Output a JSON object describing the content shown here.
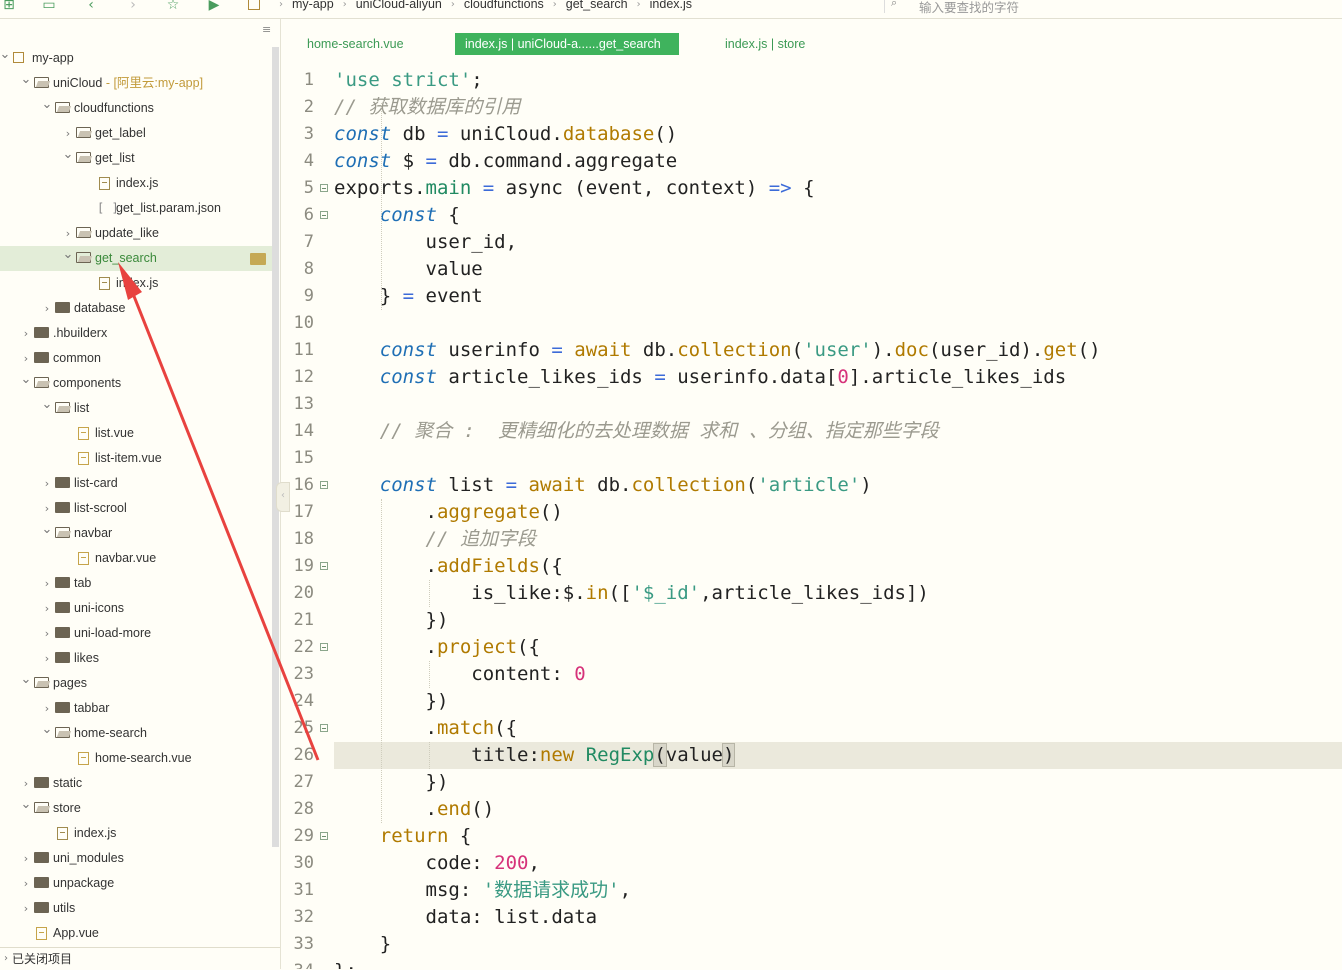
{
  "toolbar": {
    "icons": [
      "new-file-icon",
      "save-icon",
      "back-icon",
      "forward-icon",
      "star-icon",
      "run-icon"
    ],
    "breadcrumb": [
      "my-app",
      "uniCloud-aliyun",
      "cloudfunctions",
      "get_search",
      "index.js"
    ],
    "search_placeholder": "输入要查找的字符"
  },
  "sidebar": {
    "tree": [
      {
        "label": "my-app",
        "suffix": "",
        "depth": 0,
        "arrow": "down",
        "icon": "project"
      },
      {
        "label": "uniCloud",
        "suffix": " - [阿里云:my-app]",
        "depth": 1,
        "arrow": "down",
        "icon": "folder-open"
      },
      {
        "label": "cloudfunctions",
        "suffix": "",
        "depth": 2,
        "arrow": "down",
        "icon": "folder-open"
      },
      {
        "label": "get_label",
        "suffix": "",
        "depth": 3,
        "arrow": "right",
        "icon": "folder-open"
      },
      {
        "label": "get_list",
        "suffix": "",
        "depth": 3,
        "arrow": "down",
        "icon": "folder-open"
      },
      {
        "label": "index.js",
        "suffix": "",
        "depth": 4,
        "arrow": "",
        "icon": "file"
      },
      {
        "label": "get_list.param.json",
        "suffix": "",
        "depth": 4,
        "arrow": "",
        "icon": "json"
      },
      {
        "label": "update_like",
        "suffix": "",
        "depth": 3,
        "arrow": "right",
        "icon": "folder-open"
      },
      {
        "label": "get_search",
        "suffix": "",
        "depth": 3,
        "arrow": "down",
        "icon": "folder-open",
        "selected": true
      },
      {
        "label": "index.js",
        "suffix": "",
        "depth": 4,
        "arrow": "",
        "icon": "file"
      },
      {
        "label": "database",
        "suffix": "",
        "depth": 2,
        "arrow": "right",
        "icon": "folder"
      },
      {
        "label": ".hbuilderx",
        "suffix": "",
        "depth": 1,
        "arrow": "right",
        "icon": "folder"
      },
      {
        "label": "common",
        "suffix": "",
        "depth": 1,
        "arrow": "right",
        "icon": "folder"
      },
      {
        "label": "components",
        "suffix": "",
        "depth": 1,
        "arrow": "down",
        "icon": "folder-open"
      },
      {
        "label": "list",
        "suffix": "",
        "depth": 2,
        "arrow": "down",
        "icon": "folder-open"
      },
      {
        "label": "list.vue",
        "suffix": "",
        "depth": 3,
        "arrow": "",
        "icon": "vue"
      },
      {
        "label": "list-item.vue",
        "suffix": "",
        "depth": 3,
        "arrow": "",
        "icon": "vue"
      },
      {
        "label": "list-card",
        "suffix": "",
        "depth": 2,
        "arrow": "right",
        "icon": "folder"
      },
      {
        "label": "list-scrool",
        "suffix": "",
        "depth": 2,
        "arrow": "right",
        "icon": "folder"
      },
      {
        "label": "navbar",
        "suffix": "",
        "depth": 2,
        "arrow": "down",
        "icon": "folder-open"
      },
      {
        "label": "navbar.vue",
        "suffix": "",
        "depth": 3,
        "arrow": "",
        "icon": "vue"
      },
      {
        "label": "tab",
        "suffix": "",
        "depth": 2,
        "arrow": "right",
        "icon": "folder"
      },
      {
        "label": "uni-icons",
        "suffix": "",
        "depth": 2,
        "arrow": "right",
        "icon": "folder"
      },
      {
        "label": "uni-load-more",
        "suffix": "",
        "depth": 2,
        "arrow": "right",
        "icon": "folder"
      },
      {
        "label": "likes",
        "suffix": "",
        "depth": 2,
        "arrow": "right",
        "icon": "folder"
      },
      {
        "label": "pages",
        "suffix": "",
        "depth": 1,
        "arrow": "down",
        "icon": "folder-open"
      },
      {
        "label": "tabbar",
        "suffix": "",
        "depth": 2,
        "arrow": "right",
        "icon": "folder"
      },
      {
        "label": "home-search",
        "suffix": "",
        "depth": 2,
        "arrow": "down",
        "icon": "folder-open"
      },
      {
        "label": "home-search.vue",
        "suffix": "",
        "depth": 3,
        "arrow": "",
        "icon": "vue"
      },
      {
        "label": "static",
        "suffix": "",
        "depth": 1,
        "arrow": "right",
        "icon": "folder"
      },
      {
        "label": "store",
        "suffix": "",
        "depth": 1,
        "arrow": "down",
        "icon": "folder-open"
      },
      {
        "label": "index.js",
        "suffix": "",
        "depth": 2,
        "arrow": "",
        "icon": "file"
      },
      {
        "label": "uni_modules",
        "suffix": "",
        "depth": 1,
        "arrow": "right",
        "icon": "folder"
      },
      {
        "label": "unpackage",
        "suffix": "",
        "depth": 1,
        "arrow": "right",
        "icon": "folder"
      },
      {
        "label": "utils",
        "suffix": "",
        "depth": 1,
        "arrow": "right",
        "icon": "folder"
      },
      {
        "label": "App.vue",
        "suffix": "",
        "depth": 1,
        "arrow": "",
        "icon": "vue"
      }
    ],
    "closed_projects_label": "已关闭项目"
  },
  "tabs": [
    {
      "label": "home-search.vue",
      "active": false
    },
    {
      "label": "index.js | uniCloud-a......get_search",
      "active": true
    },
    {
      "label": "index.js | store",
      "active": false
    }
  ],
  "editor": {
    "current_line": 26,
    "lines": [
      {
        "n": 1,
        "fold": false,
        "tokens": [
          [
            "str",
            "'use strict'"
          ],
          [
            "",
            "; "
          ]
        ]
      },
      {
        "n": 2,
        "fold": false,
        "tokens": [
          [
            "cmt",
            "// 获取数据库的引用"
          ]
        ]
      },
      {
        "n": 3,
        "fold": false,
        "tokens": [
          [
            "kw",
            "const"
          ],
          [
            "",
            " db "
          ],
          [
            "op",
            "="
          ],
          [
            "",
            " uniCloud."
          ],
          [
            "fn",
            "database"
          ],
          [
            "",
            "()"
          ]
        ]
      },
      {
        "n": 4,
        "fold": false,
        "tokens": [
          [
            "kw",
            "const"
          ],
          [
            "",
            " $ "
          ],
          [
            "op",
            "="
          ],
          [
            "",
            " db.command.aggregate"
          ]
        ]
      },
      {
        "n": 5,
        "fold": true,
        "tokens": [
          [
            "",
            "exports."
          ],
          [
            "prop",
            "main"
          ],
          [
            "",
            " "
          ],
          [
            "op",
            "="
          ],
          [
            "",
            " async (event, context) "
          ],
          [
            "op",
            "=>"
          ],
          [
            "",
            " {"
          ]
        ]
      },
      {
        "n": 6,
        "fold": true,
        "tokens": [
          [
            "",
            "    "
          ],
          [
            "kw",
            "const"
          ],
          [
            "",
            " {"
          ]
        ]
      },
      {
        "n": 7,
        "fold": false,
        "tokens": [
          [
            "",
            "        user_id,"
          ]
        ]
      },
      {
        "n": 8,
        "fold": false,
        "tokens": [
          [
            "",
            "        value"
          ]
        ]
      },
      {
        "n": 9,
        "fold": false,
        "tokens": [
          [
            "",
            "    } "
          ],
          [
            "op",
            "="
          ],
          [
            "",
            " event"
          ]
        ]
      },
      {
        "n": 10,
        "fold": false,
        "tokens": [
          [
            "",
            ""
          ]
        ]
      },
      {
        "n": 11,
        "fold": false,
        "tokens": [
          [
            "",
            "    "
          ],
          [
            "kw",
            "const"
          ],
          [
            "",
            " userinfo "
          ],
          [
            "op",
            "="
          ],
          [
            "",
            " "
          ],
          [
            "fn",
            "await"
          ],
          [
            "",
            " db."
          ],
          [
            "fn",
            "collection"
          ],
          [
            "",
            "("
          ],
          [
            "str",
            "'user'"
          ],
          [
            "",
            ")."
          ],
          [
            "fn",
            "doc"
          ],
          [
            "",
            "(user_id)."
          ],
          [
            "fn",
            "get"
          ],
          [
            "",
            "()"
          ]
        ]
      },
      {
        "n": 12,
        "fold": false,
        "tokens": [
          [
            "",
            "    "
          ],
          [
            "kw",
            "const"
          ],
          [
            "",
            " article_likes_ids "
          ],
          [
            "op",
            "="
          ],
          [
            "",
            " userinfo.data["
          ],
          [
            "num",
            "0"
          ],
          [
            "",
            "].article_likes_ids"
          ]
        ]
      },
      {
        "n": 13,
        "fold": false,
        "tokens": [
          [
            "",
            ""
          ]
        ]
      },
      {
        "n": 14,
        "fold": false,
        "tokens": [
          [
            "",
            "    "
          ],
          [
            "cmt",
            "// 聚合 :  更精细化的去处理数据 求和 、分组、指定那些字段"
          ]
        ]
      },
      {
        "n": 15,
        "fold": false,
        "tokens": [
          [
            "",
            ""
          ]
        ]
      },
      {
        "n": 16,
        "fold": true,
        "tokens": [
          [
            "",
            "    "
          ],
          [
            "kw",
            "const"
          ],
          [
            "",
            " list "
          ],
          [
            "op",
            "="
          ],
          [
            "",
            " "
          ],
          [
            "fn",
            "await"
          ],
          [
            "",
            " db."
          ],
          [
            "fn",
            "collection"
          ],
          [
            "",
            "("
          ],
          [
            "str",
            "'article'"
          ],
          [
            "",
            ")"
          ]
        ]
      },
      {
        "n": 17,
        "fold": false,
        "tokens": [
          [
            "",
            "        ."
          ],
          [
            "fn",
            "aggregate"
          ],
          [
            "",
            "()"
          ]
        ]
      },
      {
        "n": 18,
        "fold": false,
        "tokens": [
          [
            "",
            "        "
          ],
          [
            "cmt",
            "// 追加字段"
          ]
        ]
      },
      {
        "n": 19,
        "fold": true,
        "tokens": [
          [
            "",
            "        ."
          ],
          [
            "fn",
            "addFields"
          ],
          [
            "",
            "({"
          ]
        ]
      },
      {
        "n": 20,
        "fold": false,
        "tokens": [
          [
            "",
            "            is_like:$."
          ],
          [
            "fn",
            "in"
          ],
          [
            "",
            "(["
          ],
          [
            "str",
            "'$_id'"
          ],
          [
            "",
            ",article_likes_ids])"
          ]
        ]
      },
      {
        "n": 21,
        "fold": false,
        "tokens": [
          [
            "",
            "        })"
          ]
        ]
      },
      {
        "n": 22,
        "fold": true,
        "tokens": [
          [
            "",
            "        ."
          ],
          [
            "fn",
            "project"
          ],
          [
            "",
            "({"
          ]
        ]
      },
      {
        "n": 23,
        "fold": false,
        "tokens": [
          [
            "",
            "            content: "
          ],
          [
            "num",
            "0"
          ]
        ]
      },
      {
        "n": 24,
        "fold": false,
        "tokens": [
          [
            "",
            "        })"
          ]
        ]
      },
      {
        "n": 25,
        "fold": true,
        "tokens": [
          [
            "",
            "        ."
          ],
          [
            "fn",
            "match"
          ],
          [
            "",
            "({"
          ]
        ]
      },
      {
        "n": 26,
        "fold": false,
        "tokens": [
          [
            "",
            "            title:"
          ],
          [
            "fn",
            "new"
          ],
          [
            "",
            " "
          ],
          [
            "prop",
            "RegExp"
          ],
          [
            "hl",
            "("
          ],
          [
            "",
            "value"
          ],
          [
            "hl",
            ")"
          ]
        ]
      },
      {
        "n": 27,
        "fold": false,
        "tokens": [
          [
            "",
            "        })"
          ]
        ]
      },
      {
        "n": 28,
        "fold": false,
        "tokens": [
          [
            "",
            "        ."
          ],
          [
            "fn",
            "end"
          ],
          [
            "",
            "()"
          ]
        ]
      },
      {
        "n": 29,
        "fold": true,
        "tokens": [
          [
            "",
            "    "
          ],
          [
            "fn",
            "return"
          ],
          [
            "",
            " {"
          ]
        ]
      },
      {
        "n": 30,
        "fold": false,
        "tokens": [
          [
            "",
            "        code: "
          ],
          [
            "num",
            "200"
          ],
          [
            "",
            ","
          ]
        ]
      },
      {
        "n": 31,
        "fold": false,
        "tokens": [
          [
            "",
            "        msg: "
          ],
          [
            "str",
            "'数据请求成功'"
          ],
          [
            "",
            ","
          ]
        ]
      },
      {
        "n": 32,
        "fold": false,
        "tokens": [
          [
            "",
            "        data: list.data"
          ]
        ]
      },
      {
        "n": 33,
        "fold": false,
        "tokens": [
          [
            "",
            "    }"
          ]
        ]
      },
      {
        "n": 34,
        "fold": false,
        "tokens": [
          [
            "",
            "};"
          ]
        ]
      }
    ]
  },
  "colors": {
    "accent": "#3fb35d",
    "background": "#fffef7",
    "annotation_arrow": "#e8423f"
  }
}
